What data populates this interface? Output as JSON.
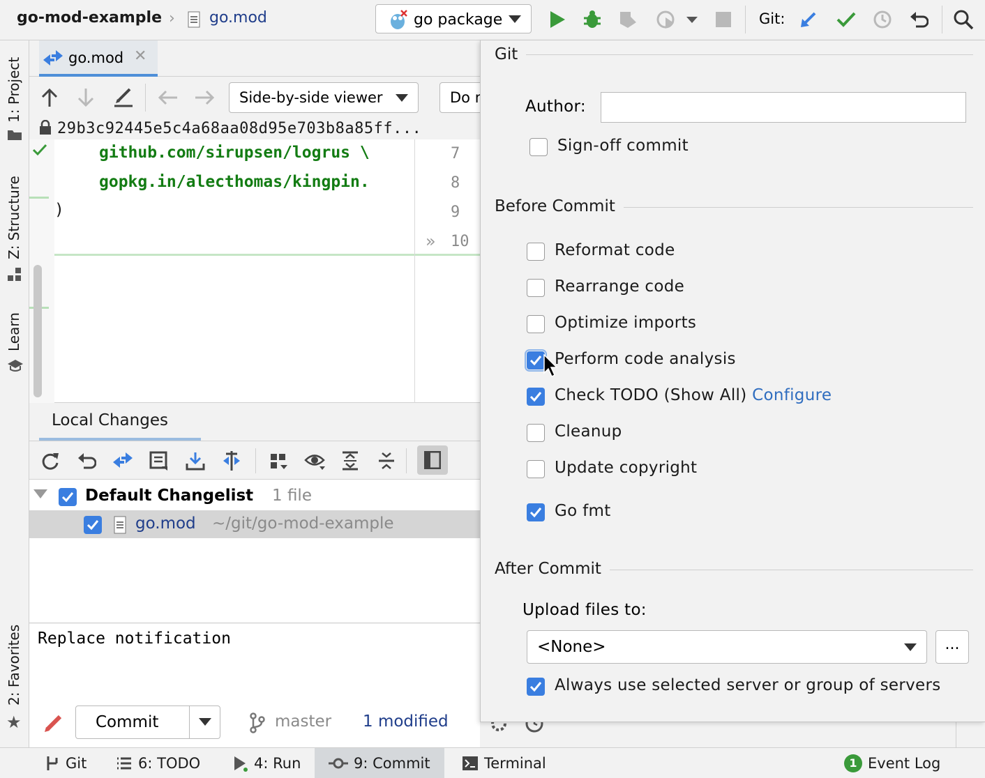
{
  "breadcrumb": {
    "project": "go-mod-example",
    "file": "go.mod"
  },
  "run_config": {
    "label": "go package"
  },
  "toolbar": {
    "git_label": "Git:"
  },
  "left_tabs": {
    "project": "1: Project",
    "structure": "Z: Structure",
    "learn": "Learn",
    "favorites": "2: Favorites"
  },
  "editor": {
    "tab_label": "go.mod",
    "viewer_select": "Side-by-side viewer",
    "second_select": "Do n",
    "revision_hash": "29b3c92445e5c4a68aa08d95e703b8a85ff...",
    "code_lines": [
      "github.com/sirupsen/logrus \\",
      "gopkg.in/alecthomas/kingpin."
    ],
    "closing_paren": ")",
    "line_numbers": [
      "7",
      "8",
      "9",
      "10"
    ]
  },
  "local_changes": {
    "tab_label": "Local Changes",
    "changelist_name": "Default Changelist",
    "changelist_count": "1 file",
    "file_name": "go.mod",
    "file_path": "~/git/go-mod-example",
    "commit_message": "Replace notification",
    "commit_button": "Commit",
    "branch": "master",
    "modified": "1 modified"
  },
  "bottom_tabs": {
    "git": "Git",
    "todo": "6: TODO",
    "run": "4: Run",
    "commit": "9: Commit",
    "terminal": "Terminal",
    "event_log": "Event Log",
    "event_badge": "1"
  },
  "git_popup": {
    "git_section": "Git",
    "author_label": "Author:",
    "author_value": "",
    "signoff": {
      "label": "Sign-off commit",
      "checked": false
    },
    "before_commit_section": "Before Commit",
    "before_options": [
      {
        "label": "Reformat code",
        "checked": false
      },
      {
        "label": "Rearrange code",
        "checked": false
      },
      {
        "label": "Optimize imports",
        "checked": false
      },
      {
        "label": "Perform code analysis",
        "checked": true
      },
      {
        "label": "Check TODO (Show All)",
        "checked": true,
        "link": "Configure"
      },
      {
        "label": "Cleanup",
        "checked": false
      },
      {
        "label": "Update copyright",
        "checked": false
      },
      {
        "label": "Go fmt",
        "checked": true
      }
    ],
    "after_commit_section": "After Commit",
    "upload_label": "Upload files to:",
    "upload_value": "<None>",
    "upload_more": "...",
    "always_use": {
      "label": "Always use selected server or group of servers",
      "checked": true
    }
  },
  "colors": {
    "accent": "#3a7ee0",
    "link": "#2f6dbf",
    "code_green": "#137c13",
    "run_green": "#3a9a3a"
  }
}
